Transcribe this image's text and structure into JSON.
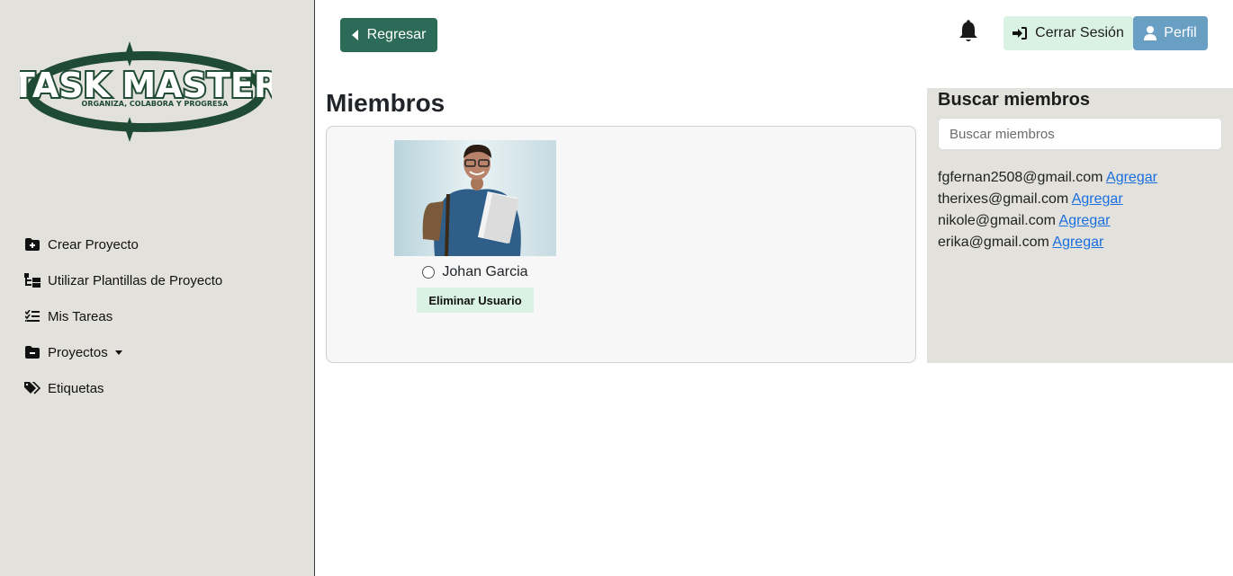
{
  "sidebar": {
    "logo": {
      "title": "TASK MASTER",
      "tagline": "ORGANIZA, COLABORA Y PROGRESA",
      "color": "#1f4a33"
    },
    "items": [
      {
        "label": "Crear Proyecto",
        "icon": "folder-plus-icon"
      },
      {
        "label": "Utilizar Plantillas de Proyecto",
        "icon": "folder-tree-icon"
      },
      {
        "label": "Mis Tareas",
        "icon": "list-check-icon"
      },
      {
        "label": "Proyectos",
        "icon": "folder-minus-icon",
        "dropdown": true
      },
      {
        "label": "Etiquetas",
        "icon": "tags-icon"
      }
    ]
  },
  "header": {
    "back_label": "Regresar",
    "logout_label": "Cerrar Sesión",
    "profile_label": "Perfil",
    "colors": {
      "back": "#2c6b58",
      "logout": "#d9f2e3",
      "profile": "#6a9fc4"
    }
  },
  "main": {
    "title": "Miembros",
    "members": [
      {
        "name": "Johan Garcia",
        "remove_label": "Eliminar Usuario"
      }
    ]
  },
  "search": {
    "title": "Buscar miembros",
    "placeholder": "Buscar miembros",
    "add_label": "Agregar",
    "results": [
      {
        "email": "fgfernan2508@gmail.com"
      },
      {
        "email": "therixes@gmail.com"
      },
      {
        "email": "nikole@gmail.com"
      },
      {
        "email": "erika@gmail.com"
      }
    ]
  }
}
